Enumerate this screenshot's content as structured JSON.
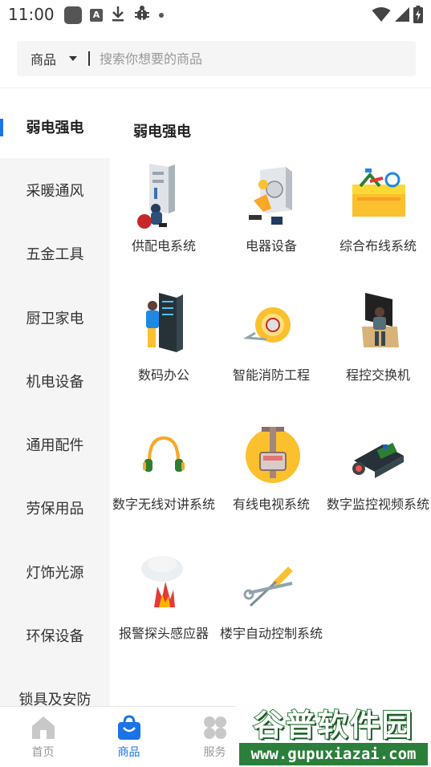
{
  "status_bar": {
    "time": "11:00",
    "left_icons": [
      "app-square-icon",
      "a-badge-icon",
      "download-icon",
      "bug-icon",
      "dot-icon"
    ],
    "right_icons": [
      "wifi-icon",
      "signal-icon",
      "battery-charging-icon"
    ]
  },
  "search": {
    "category_label": "商品",
    "placeholder": "搜索你想要的商品"
  },
  "sidebar": {
    "items": [
      {
        "label": "弱电强电",
        "active": true
      },
      {
        "label": "采暖通风"
      },
      {
        "label": "五金工具"
      },
      {
        "label": "厨卫家电"
      },
      {
        "label": "机电设备"
      },
      {
        "label": "通用配件"
      },
      {
        "label": "劳保用品"
      },
      {
        "label": "灯饰光源"
      },
      {
        "label": "环保设备"
      },
      {
        "label": "锁具及安防"
      }
    ]
  },
  "content": {
    "section_title": "弱电强电",
    "items": [
      {
        "label": "供配电系统",
        "icon": "power-cabinet-worker-icon"
      },
      {
        "label": "电器设备",
        "icon": "electrical-equipment-worker-icon"
      },
      {
        "label": "综合布线系统",
        "icon": "cabling-toolbox-icon"
      },
      {
        "label": "数码办公",
        "icon": "server-rack-operator-icon"
      },
      {
        "label": "智能消防工程",
        "icon": "fire-hose-reel-icon"
      },
      {
        "label": "程控交换机",
        "icon": "switchboard-operator-icon"
      },
      {
        "label": "数字无线对讲系统",
        "icon": "headphones-icon"
      },
      {
        "label": "有线电视系统",
        "icon": "cable-tv-tower-icon"
      },
      {
        "label": "数字监控视频系统",
        "icon": "surveillance-camera-icon"
      },
      {
        "label": "报警探头感应器",
        "icon": "smoke-fire-alarm-icon"
      },
      {
        "label": "楼宇自动控制系统",
        "icon": "screwdriver-wrench-icon"
      }
    ]
  },
  "tabbar": {
    "tabs": [
      {
        "label": "首页",
        "icon": "home-icon"
      },
      {
        "label": "商品",
        "icon": "shopping-bag-icon",
        "active": true
      },
      {
        "label": "服务",
        "icon": "services-grid-icon"
      }
    ]
  },
  "watermark": {
    "title": "谷普软件园",
    "url": "www.gupuxiazai.com"
  },
  "colors": {
    "accent": "#1a73e8",
    "sidebar_bg": "#f5f5f5",
    "watermark_green": "#2a7f3a"
  }
}
